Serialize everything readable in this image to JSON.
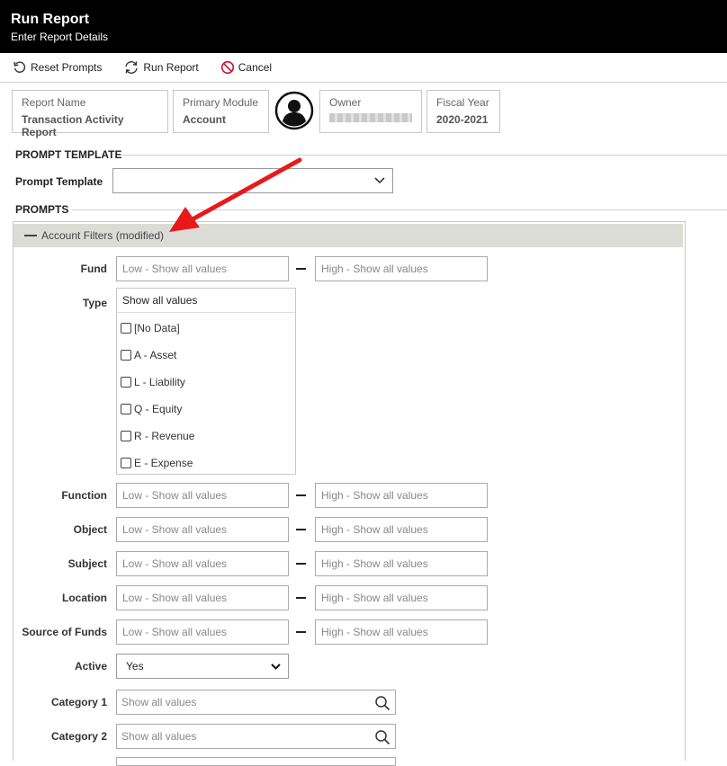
{
  "titlebar": {
    "title": "Run Report",
    "subtitle": "Enter Report Details"
  },
  "toolbar": {
    "reset_label": "Reset Prompts",
    "run_label": "Run Report",
    "cancel_label": "Cancel"
  },
  "report_info": {
    "report_name_label": "Report Name",
    "report_name_value": "Transaction Activity Report",
    "primary_module_label": "Primary Module",
    "primary_module_value": "Account",
    "owner_label": "Owner",
    "fiscal_year_label": "Fiscal Year",
    "fiscal_year_value": "2020-2021"
  },
  "prompt_template": {
    "section_title": "PROMPT TEMPLATE",
    "label": "Prompt Template",
    "value": ""
  },
  "prompts": {
    "section_title": "PROMPTS",
    "panel_title": "Account Filters (modified)",
    "low_placeholder": "Low - Show all values",
    "high_placeholder": "High - Show all values",
    "fund_label": "Fund",
    "type_label": "Type",
    "type_header": "Show all values",
    "type_options": [
      "[No Data]",
      "A - Asset",
      "L - Liability",
      "Q - Equity",
      "R - Revenue",
      "E - Expense"
    ],
    "function_label": "Function",
    "object_label": "Object",
    "subject_label": "Subject",
    "location_label": "Location",
    "source_label": "Source of Funds",
    "active_label": "Active",
    "active_value": "Yes",
    "category1_label": "Category 1",
    "category1_placeholder": "Show all values",
    "category2_label": "Category 2",
    "category2_placeholder": "Show all values"
  },
  "colors": {
    "titlebar_bg": "#000000",
    "annotation_arrow": "#e8191b",
    "cancel_icon": "#c8102e"
  }
}
